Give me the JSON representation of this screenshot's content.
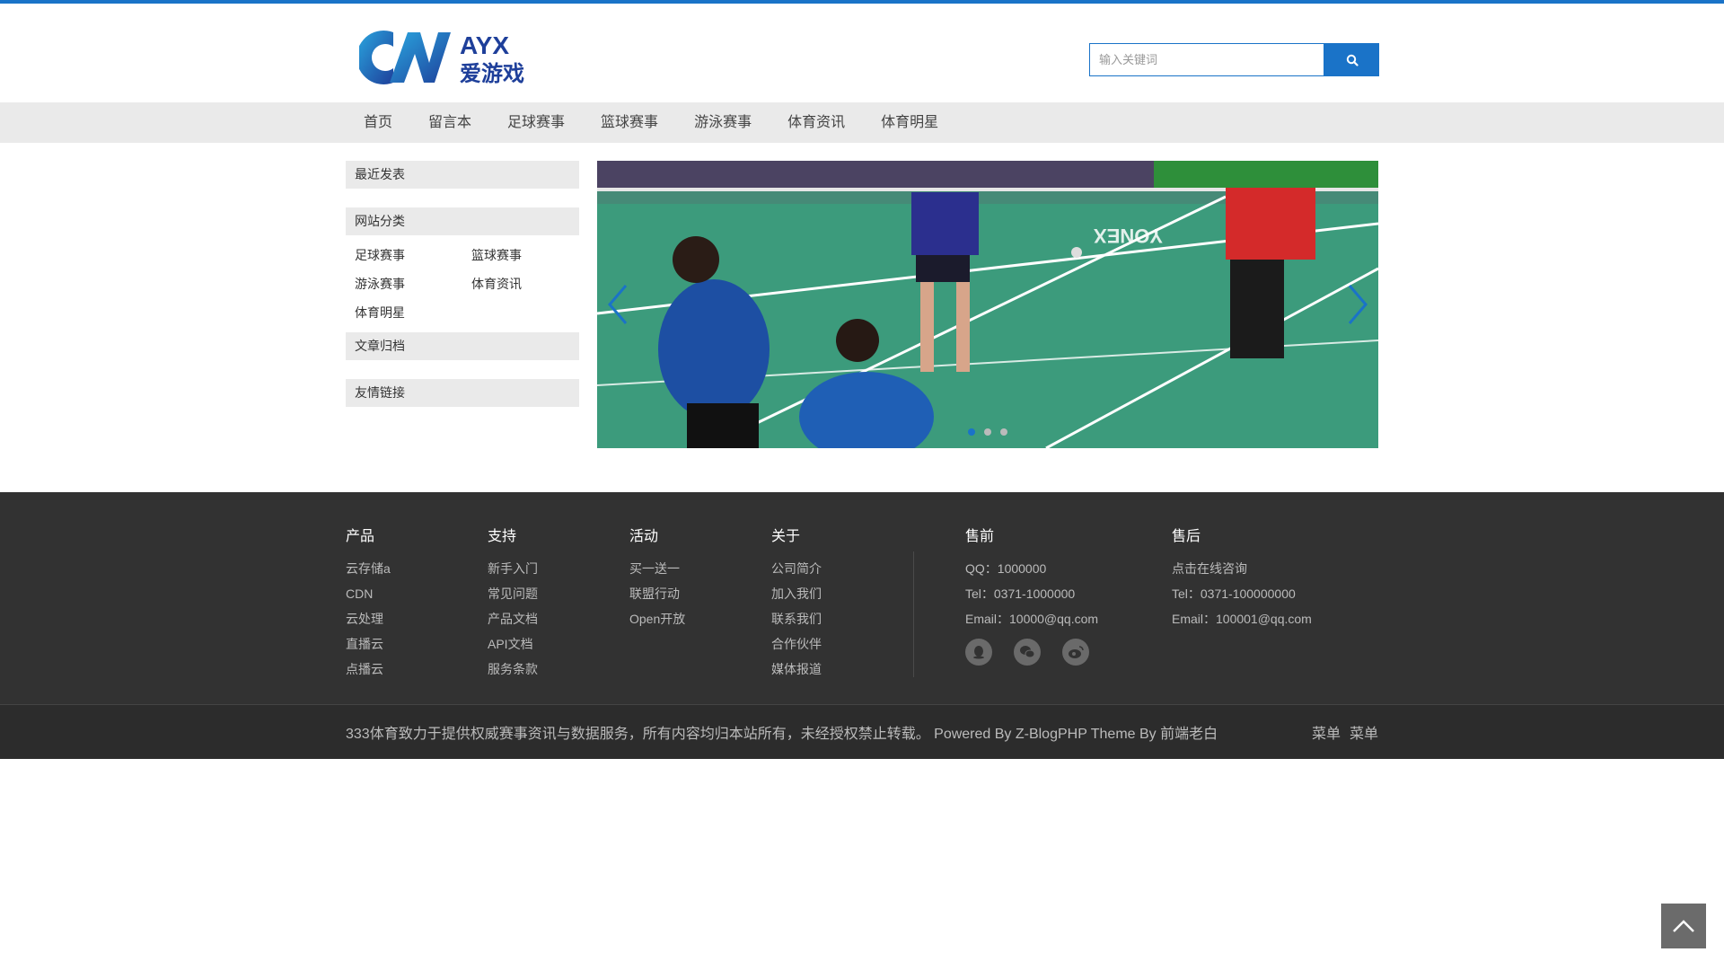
{
  "header": {
    "logo_text": "AYX",
    "logo_subtext": "爱游戏",
    "search_placeholder": "输入关键词",
    "search_icon": "search-icon"
  },
  "nav": {
    "items": [
      "首页",
      "留言本",
      "足球赛事",
      "篮球赛事",
      "游泳赛事",
      "体育资讯",
      "体育明星"
    ]
  },
  "sidebar": {
    "recent_title": "最近发表",
    "categories_title": "网站分类",
    "categories": [
      "足球赛事",
      "篮球赛事",
      "游泳赛事",
      "体育资讯",
      "体育明星"
    ],
    "archive_title": "文章归档",
    "links_title": "友情链接"
  },
  "slider": {
    "slides": 3,
    "active_slide": 1,
    "prev_icon": "chevron-left-icon",
    "next_icon": "chevron-right-icon",
    "image_text": "YONEX"
  },
  "footer": {
    "columns": [
      {
        "title": "产品",
        "items": [
          "云存储a",
          "CDN",
          "云处理",
          "直播云",
          "点播云"
        ]
      },
      {
        "title": "支持",
        "items": [
          "新手入门",
          "常见问题",
          "产品文档",
          "API文档",
          "服务条款"
        ]
      },
      {
        "title": "活动",
        "items": [
          "买一送一",
          "联盟行动",
          "Open开放"
        ]
      },
      {
        "title": "关于",
        "items": [
          "公司简介",
          "加入我们",
          "联系我们",
          "合作伙伴",
          "媒体报道"
        ]
      }
    ],
    "presale": {
      "title": "售前",
      "items": [
        "QQ：1000000",
        "Tel：0371-1000000",
        "Email：10000@qq.com"
      ]
    },
    "aftersale": {
      "title": "售后",
      "items": [
        "点击在线咨询",
        "Tel：0371-100000000",
        "Email：100001@qq.com"
      ]
    },
    "social_icons": [
      "qq-icon",
      "wechat-icon",
      "weibo-icon"
    ],
    "copyright": "333体育致力于提供权威赛事资讯与数据服务，所有内容均归本站所有，未经授权禁止转载。 Powered By Z-BlogPHP Theme By 前端老白",
    "bottom_menu": [
      "菜单",
      "菜单"
    ]
  },
  "back_to_top_icon": "chevron-up-icon",
  "colors": {
    "accent": "#1a73c8",
    "nav_bg": "#eaeaea",
    "footer_bg": "#323232"
  }
}
